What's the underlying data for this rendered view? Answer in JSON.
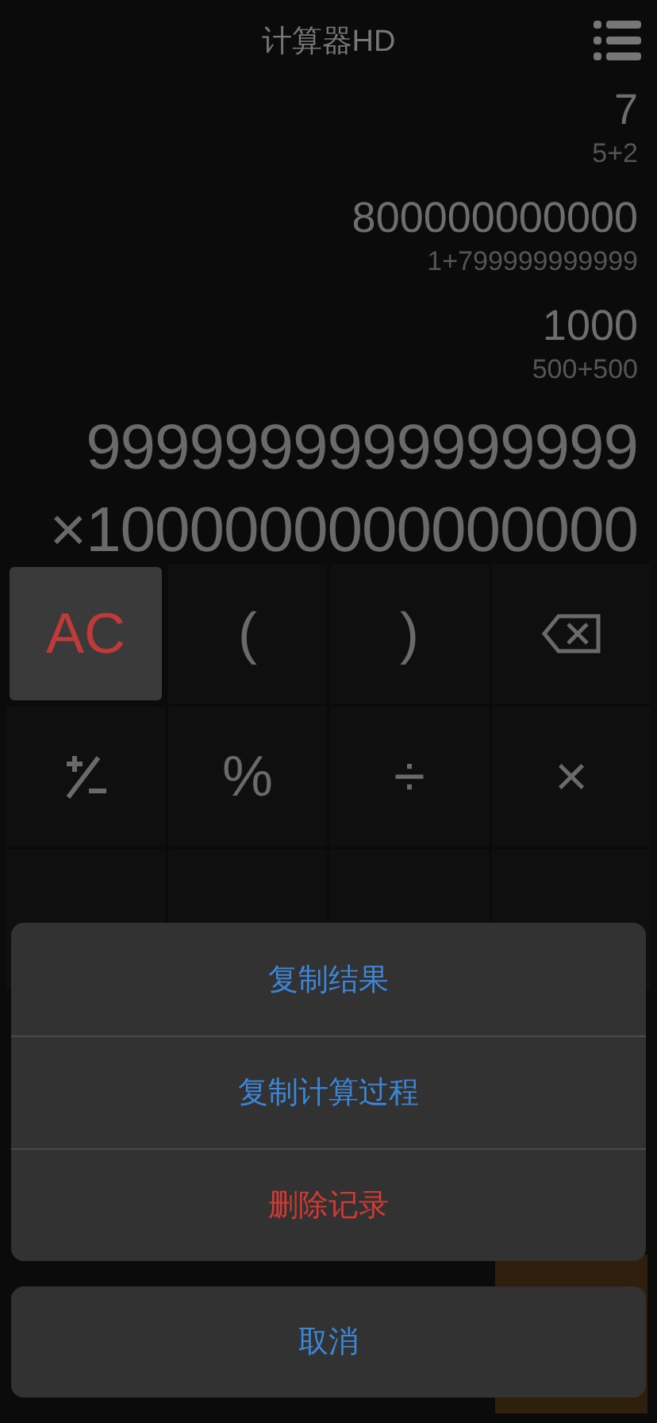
{
  "header": {
    "title": "计算器HD"
  },
  "history": [
    {
      "result": "7",
      "expression": "5+2"
    },
    {
      "result": "800000000000",
      "expression": "1+799999999999"
    },
    {
      "result": "1000",
      "expression": "500+500"
    }
  ],
  "current": {
    "lines": [
      "9999999999999999",
      "×1000000000000000"
    ]
  },
  "keypad": [
    {
      "kind": "clear",
      "label": "AC"
    },
    {
      "kind": "text",
      "label": "("
    },
    {
      "kind": "text",
      "label": ")"
    },
    {
      "kind": "backspace"
    },
    {
      "kind": "sign"
    },
    {
      "kind": "text",
      "label": "%"
    },
    {
      "kind": "text",
      "label": "÷"
    },
    {
      "kind": "text",
      "label": "×"
    },
    {
      "kind": "covered"
    },
    {
      "kind": "covered"
    },
    {
      "kind": "covered"
    },
    {
      "kind": "covered"
    }
  ],
  "action_sheet": {
    "items": [
      {
        "label": "复制结果",
        "kind": "normal"
      },
      {
        "label": "复制计算过程",
        "kind": "normal"
      },
      {
        "label": "删除记录",
        "kind": "destructive"
      }
    ],
    "cancel": "取消"
  }
}
